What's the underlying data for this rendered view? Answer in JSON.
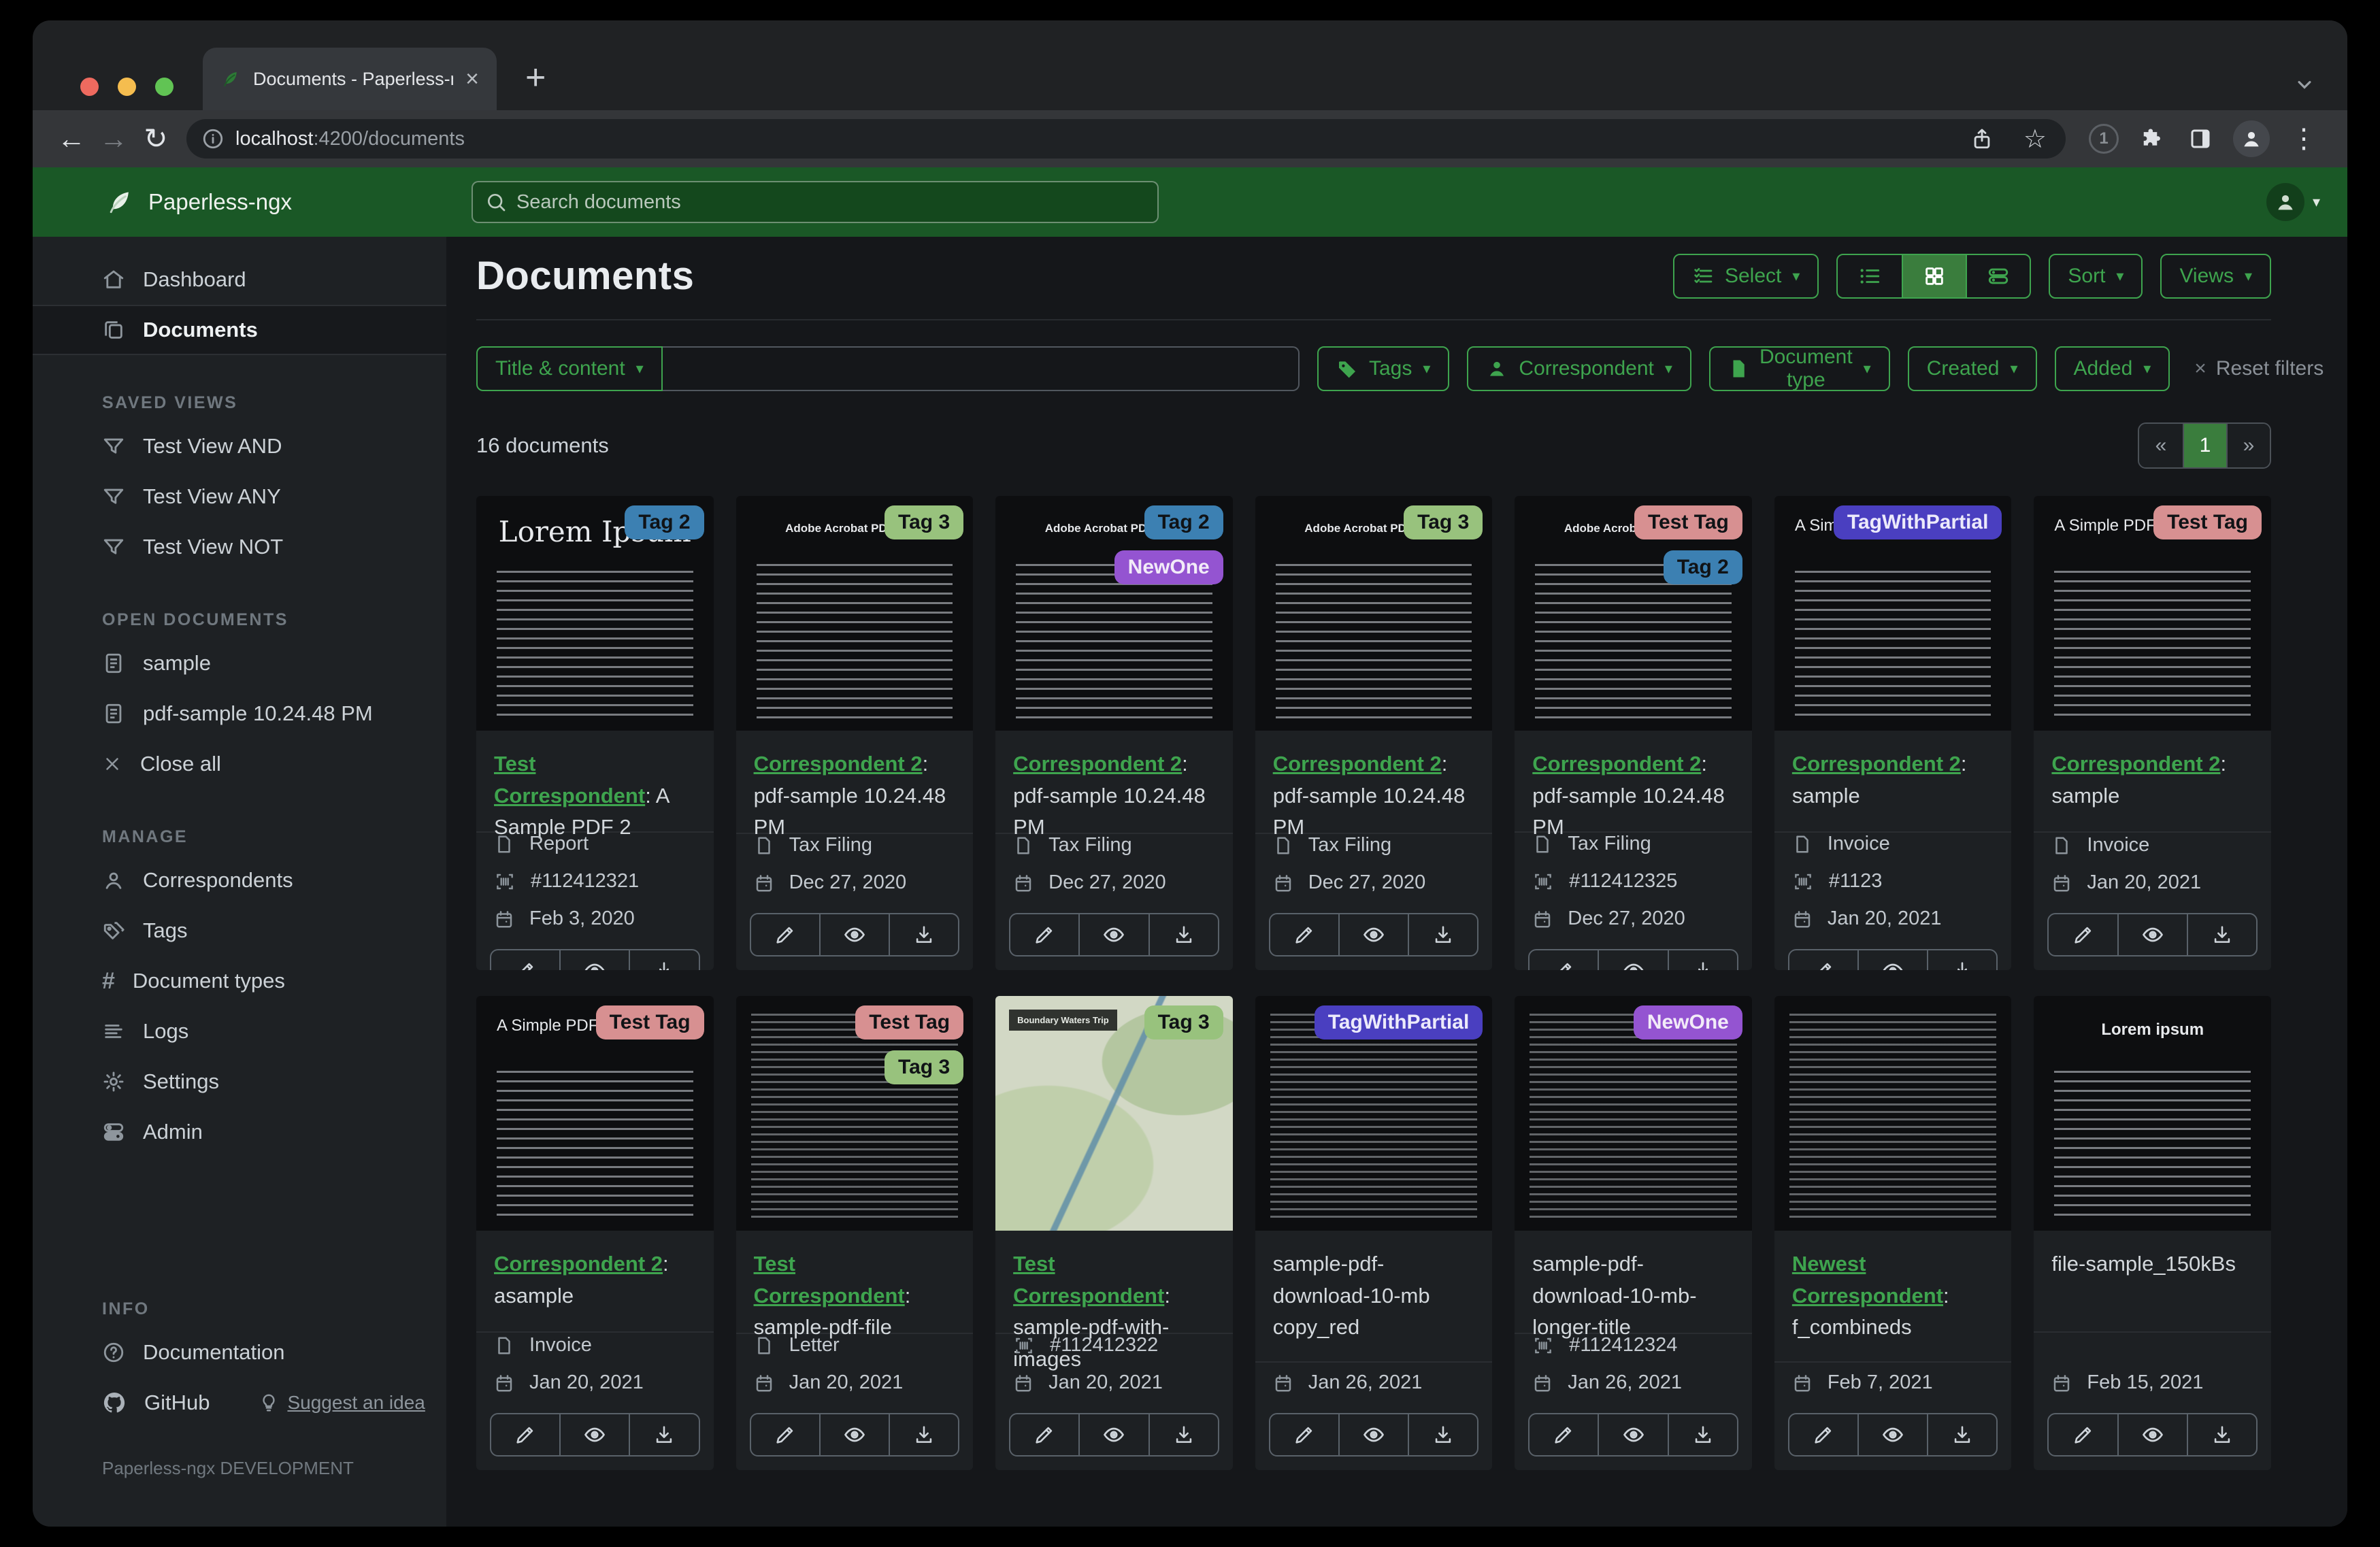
{
  "browser": {
    "tab_title": "Documents - Paperless-ngx",
    "url_host": "localhost",
    "url_path": ":4200/documents"
  },
  "icons": {
    "caret_down": "▾",
    "close": "×",
    "new_tab": "+",
    "back": "←",
    "forward": "→",
    "reload": "↻",
    "overflow_menu": "⋮",
    "bookmark_star": "☆",
    "hash": "#",
    "extension_badge": "1"
  },
  "colors": {
    "accent_green": "#3ea44e",
    "header_green": "#1a5826",
    "active_green": "#3a7d3d",
    "traffic_red": "#ee6a5f",
    "traffic_yellow": "#f5bd4f",
    "traffic_green": "#61c454"
  },
  "app_header": {
    "brand": "Paperless-ngx",
    "search_placeholder": "Search documents"
  },
  "sidebar": {
    "dashboard": "Dashboard",
    "documents": "Documents",
    "saved_views_header": "SAVED VIEWS",
    "saved_views": [
      "Test View AND",
      "Test View ANY",
      "Test View NOT"
    ],
    "open_documents_header": "OPEN DOCUMENTS",
    "open_documents": [
      "sample",
      "pdf-sample 10.24.48 PM"
    ],
    "close_all": "Close all",
    "manage_header": "MANAGE",
    "manage": [
      "Correspondents",
      "Tags",
      "Document types",
      "Logs",
      "Settings",
      "Admin"
    ],
    "info_header": "INFO",
    "documentation": "Documentation",
    "github": "GitHub",
    "suggest": "Suggest an idea",
    "footer": "Paperless-ngx DEVELOPMENT"
  },
  "main": {
    "title": "Documents",
    "select_label": "Select",
    "sort_label": "Sort",
    "views_label": "Views",
    "filter_field_label": "Title & content",
    "filter_tags": "Tags",
    "filter_correspondent": "Correspondent",
    "filter_doctype": "Document type",
    "filter_created": "Created",
    "filter_added": "Added",
    "reset_filters": "Reset filters",
    "count": "16 documents",
    "pager_prev": "«",
    "pager_page": "1",
    "pager_next": "»"
  },
  "cards": [
    {
      "thumb": "lorem-serif",
      "thumb_heading": "Lorem Ipsum",
      "tag1": {
        "label": "Tag 2",
        "bg": "#3c80b2",
        "fg": "#101316"
      },
      "correspondent": "Test Correspondent",
      "title_rest": ": A Sample PDF 2",
      "doc_type": "Report",
      "asn": "#112412321",
      "date": "Feb 3, 2020"
    },
    {
      "thumb": "acrobat",
      "thumb_heading": "Adobe Acrobat PDF Files",
      "tag1": {
        "label": "Tag 3",
        "bg": "#98c27d",
        "fg": "#101316"
      },
      "correspondent": "Correspondent 2",
      "title_rest": ": pdf-sample 10.24.48 PM",
      "doc_type": "Tax Filing",
      "date": "Dec 27, 2020"
    },
    {
      "thumb": "acrobat",
      "thumb_heading": "Adobe Acrobat PDF Files",
      "tag1": {
        "label": "Tag 2",
        "bg": "#3c80b2",
        "fg": "#101316"
      },
      "tag2": {
        "label": "NewOne",
        "bg": "#9454d1",
        "fg": "#f2ebf8"
      },
      "correspondent": "Correspondent 2",
      "title_rest": ": pdf-sample 10.24.48 PM",
      "doc_type": "Tax Filing",
      "date": "Dec 27, 2020"
    },
    {
      "thumb": "acrobat",
      "thumb_heading": "Adobe Acrobat PDF Files",
      "tag1": {
        "label": "Tag 3",
        "bg": "#98c27d",
        "fg": "#101316"
      },
      "correspondent": "Correspondent 2",
      "title_rest": ": pdf-sample 10.24.48 PM",
      "doc_type": "Tax Filing",
      "date": "Dec 27, 2020"
    },
    {
      "thumb": "acrobat",
      "thumb_heading": "Adobe Acrobat PDF Files",
      "tag1": {
        "label": "Test Tag",
        "bg": "#d79091",
        "fg": "#101316"
      },
      "tag2": {
        "label": "Tag 2",
        "bg": "#3c80b2",
        "fg": "#101316"
      },
      "correspondent": "Correspondent 2",
      "title_rest": ": pdf-sample 10.24.48 PM",
      "doc_type": "Tax Filing",
      "asn": "#112412325",
      "date": "Dec 27, 2020"
    },
    {
      "thumb": "simple",
      "thumb_heading": "A Simple PDF File",
      "tag1": {
        "label": "TagWithPartial",
        "bg": "#4a3fc0",
        "fg": "#eceafb"
      },
      "correspondent": "Correspondent 2",
      "title_rest": ": sample",
      "doc_type": "Invoice",
      "asn": "#1123",
      "date": "Jan 20, 2021"
    },
    {
      "thumb": "simple",
      "thumb_heading": "A Simple PDF File",
      "tag1": {
        "label": "Test Tag",
        "bg": "#d79091",
        "fg": "#101316"
      },
      "correspondent": "Correspondent 2",
      "title_rest": ": sample",
      "doc_type": "Invoice",
      "date": "Jan 20, 2021"
    },
    {
      "thumb": "simple",
      "thumb_heading": "A Simple PDF File",
      "tag1": {
        "label": "Test Tag",
        "bg": "#d79091",
        "fg": "#101316"
      },
      "correspondent": "Correspondent 2",
      "title_rest": ": asample",
      "doc_type": "Invoice",
      "date": "Jan 20, 2021"
    },
    {
      "thumb": "dense",
      "tag1": {
        "label": "Test Tag",
        "bg": "#d79091",
        "fg": "#101316"
      },
      "tag2": {
        "label": "Tag 3",
        "bg": "#98c27d",
        "fg": "#101316"
      },
      "correspondent": "Test Correspondent",
      "title_rest": ": sample-pdf-file",
      "doc_type": "Letter",
      "date": "Jan 20, 2021"
    },
    {
      "thumb": "map",
      "thumb_heading": "Boundary Waters Trip",
      "tag1": {
        "label": "Tag 3",
        "bg": "#98c27d",
        "fg": "#101316"
      },
      "correspondent": "Test Correspondent",
      "title_rest": ": sample-pdf-with-images",
      "asn": "#112412322",
      "date": "Jan 20, 2021"
    },
    {
      "thumb": "dense",
      "tag1": {
        "label": "TagWithPartial",
        "bg": "#4a3fc0",
        "fg": "#eceafb"
      },
      "title_rest": "sample-pdf-download-10-mb copy_red",
      "date": "Jan 26, 2021"
    },
    {
      "thumb": "dense",
      "tag1": {
        "label": "NewOne",
        "bg": "#9454d1",
        "fg": "#f2ebf8"
      },
      "title_rest": "sample-pdf-download-10-mb-longer-title",
      "asn": "#112412324",
      "date": "Jan 26, 2021"
    },
    {
      "thumb": "dense",
      "correspondent": "Newest Correspondent",
      "title_rest": ": f_combineds",
      "date": "Feb 7, 2021"
    },
    {
      "thumb": "lorem-center",
      "thumb_heading": "Lorem ipsum",
      "title_rest": "file-sample_150kBs",
      "date": "Feb 15, 2021"
    }
  ]
}
